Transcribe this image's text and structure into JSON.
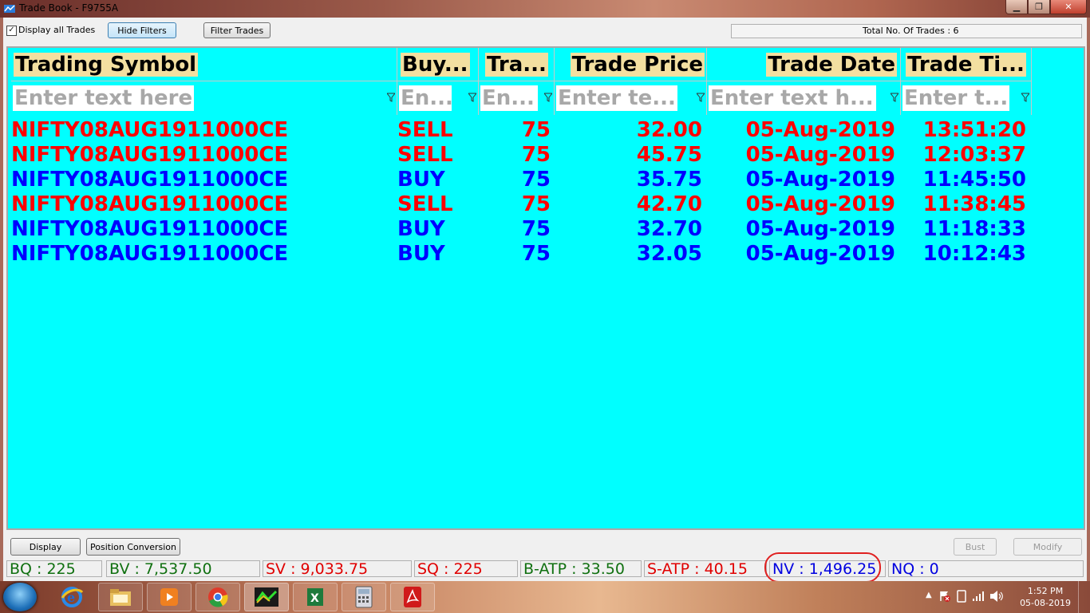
{
  "window": {
    "title": "Trade Book - F9755A"
  },
  "toolbar": {
    "display_all_checked": "✓",
    "display_all_label": "Display all Trades",
    "hide_filters": "Hide Filters",
    "filter_trades": "Filter Trades",
    "total_trades": "Total No. Of Trades : 6"
  },
  "grid": {
    "headers": [
      "Trading Symbol",
      "Buy...",
      "Tra...",
      "Trade Price",
      "Trade Date",
      "Trade Ti..."
    ],
    "filters": [
      "Enter text here",
      "En...",
      "En...",
      "Enter te...",
      "Enter text h...",
      "Enter t..."
    ],
    "rows": [
      {
        "symbol": "NIFTY08AUG1911000CE",
        "side": "SELL",
        "qty": "75",
        "price": "32.00",
        "date": "05-Aug-2019",
        "time": "13:51:20",
        "color": "#ff0000"
      },
      {
        "symbol": "NIFTY08AUG1911000CE",
        "side": "SELL",
        "qty": "75",
        "price": "45.75",
        "date": "05-Aug-2019",
        "time": "12:03:37",
        "color": "#ff0000"
      },
      {
        "symbol": "NIFTY08AUG1911000CE",
        "side": "BUY",
        "qty": "75",
        "price": "35.75",
        "date": "05-Aug-2019",
        "time": "11:45:50",
        "color": "#0000ff"
      },
      {
        "symbol": "NIFTY08AUG1911000CE",
        "side": "SELL",
        "qty": "75",
        "price": "42.70",
        "date": "05-Aug-2019",
        "time": "11:38:45",
        "color": "#ff0000"
      },
      {
        "symbol": "NIFTY08AUG1911000CE",
        "side": "BUY",
        "qty": "75",
        "price": "32.70",
        "date": "05-Aug-2019",
        "time": "11:18:33",
        "color": "#0000ff"
      },
      {
        "symbol": "NIFTY08AUG1911000CE",
        "side": "BUY",
        "qty": "75",
        "price": "32.05",
        "date": "05-Aug-2019",
        "time": "10:12:43",
        "color": "#0000ff"
      }
    ]
  },
  "actions": {
    "display": "Display",
    "position_conversion": "Position Conversion",
    "bust": "Bust",
    "modify": "Modify"
  },
  "status": {
    "bq": "BQ : 225",
    "bv": "BV : 7,537.50",
    "sv": "SV : 9,033.75",
    "sq": "SQ : 225",
    "batp": "B-ATP : 33.50",
    "satp": "S-ATP : 40.15",
    "nv": "NV : 1,496.25",
    "nq": "NQ : 0"
  },
  "taskbar": {
    "time": "1:52 PM",
    "date": "05-08-2019"
  },
  "colors": {
    "grid_bg": "#00ffff",
    "sell": "#ff0000",
    "buy": "#0000ff",
    "header_label_bg": "#f3dfa0"
  }
}
